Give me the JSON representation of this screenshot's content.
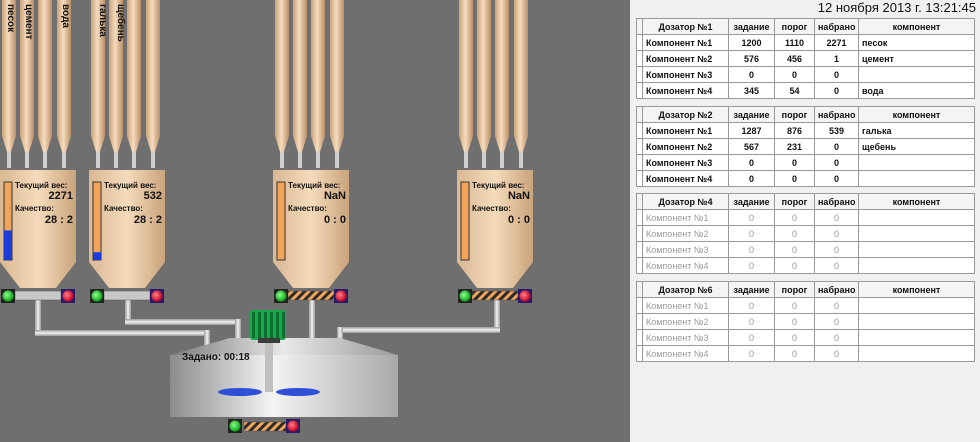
{
  "datetime": "12 ноября 2013 г. 13:21:45",
  "silo_labels": [
    "песок",
    "цемент",
    "вода",
    "галька",
    "щебень"
  ],
  "hoppers": [
    {
      "weight_label": "Текущий вес:",
      "weight": "2271",
      "quality_label": "Качество:",
      "quality": "28 : 2",
      "level": 0.38
    },
    {
      "weight_label": "Текущий вес:",
      "weight": "532",
      "quality_label": "Качество:",
      "quality": "28 : 2",
      "level": 0.1
    },
    {
      "weight_label": "Текущий вес:",
      "weight": "NaN",
      "quality_label": "Качество:",
      "quality": "0 : 0",
      "level": 0
    },
    {
      "weight_label": "Текущий вес:",
      "weight": "NaN",
      "quality_label": "Качество:",
      "quality": "0 : 0",
      "level": 0
    }
  ],
  "mixer": {
    "time_label": "Задано: 00:18"
  },
  "colors": {
    "silo": "#f2d5b4",
    "level": "#1c3bdc",
    "indicator_on": "#17c21f",
    "indicator_off": "#e3001a",
    "motor": "#17a84a"
  },
  "icons": [
    "motor-icon",
    "green-indicator-icon",
    "red-indicator-icon"
  ],
  "dozers": [
    {
      "title": "Дозатор №1",
      "active": true,
      "headers": [
        "задание",
        "порог",
        "набрано",
        "компонент"
      ],
      "rows": [
        {
          "label": "Компонент №1",
          "task": "1200",
          "threshold": "1110",
          "collected": "2271",
          "component": "песок"
        },
        {
          "label": "Компонент №2",
          "task": "576",
          "threshold": "456",
          "collected": "1",
          "component": "цемент"
        },
        {
          "label": "Компонент №3",
          "task": "0",
          "threshold": "0",
          "collected": "0",
          "component": ""
        },
        {
          "label": "Компонент №4",
          "task": "345",
          "threshold": "54",
          "collected": "0",
          "component": "вода"
        }
      ]
    },
    {
      "title": "Дозатор №2",
      "active": true,
      "headers": [
        "задание",
        "порог",
        "набрано",
        "компонент"
      ],
      "rows": [
        {
          "label": "Компонент №1",
          "task": "1287",
          "threshold": "876",
          "collected": "539",
          "component": "галька"
        },
        {
          "label": "Компонент №2",
          "task": "567",
          "threshold": "231",
          "collected": "0",
          "component": "щебень"
        },
        {
          "label": "Компонент №3",
          "task": "0",
          "threshold": "0",
          "collected": "0",
          "component": ""
        },
        {
          "label": "Компонент №4",
          "task": "0",
          "threshold": "0",
          "collected": "0",
          "component": ""
        }
      ]
    },
    {
      "title": "Дозатор №4",
      "active": false,
      "headers": [
        "задание",
        "порог",
        "набрано",
        "компонент"
      ],
      "rows": [
        {
          "label": "Компонент №1",
          "task": "0",
          "threshold": "0",
          "collected": "0",
          "component": ""
        },
        {
          "label": "Компонент №2",
          "task": "0",
          "threshold": "0",
          "collected": "0",
          "component": ""
        },
        {
          "label": "Компонент №3",
          "task": "0",
          "threshold": "0",
          "collected": "0",
          "component": ""
        },
        {
          "label": "Компонент №4",
          "task": "0",
          "threshold": "0",
          "collected": "0",
          "component": ""
        }
      ]
    },
    {
      "title": "Дозатор №6",
      "active": false,
      "headers": [
        "задание",
        "порог",
        "набрано",
        "компонент"
      ],
      "rows": [
        {
          "label": "Компонент №1",
          "task": "0",
          "threshold": "0",
          "collected": "0",
          "component": ""
        },
        {
          "label": "Компонент №2",
          "task": "0",
          "threshold": "0",
          "collected": "0",
          "component": ""
        },
        {
          "label": "Компонент №3",
          "task": "0",
          "threshold": "0",
          "collected": "0",
          "component": ""
        },
        {
          "label": "Компонент №4",
          "task": "0",
          "threshold": "0",
          "collected": "0",
          "component": ""
        }
      ]
    }
  ]
}
